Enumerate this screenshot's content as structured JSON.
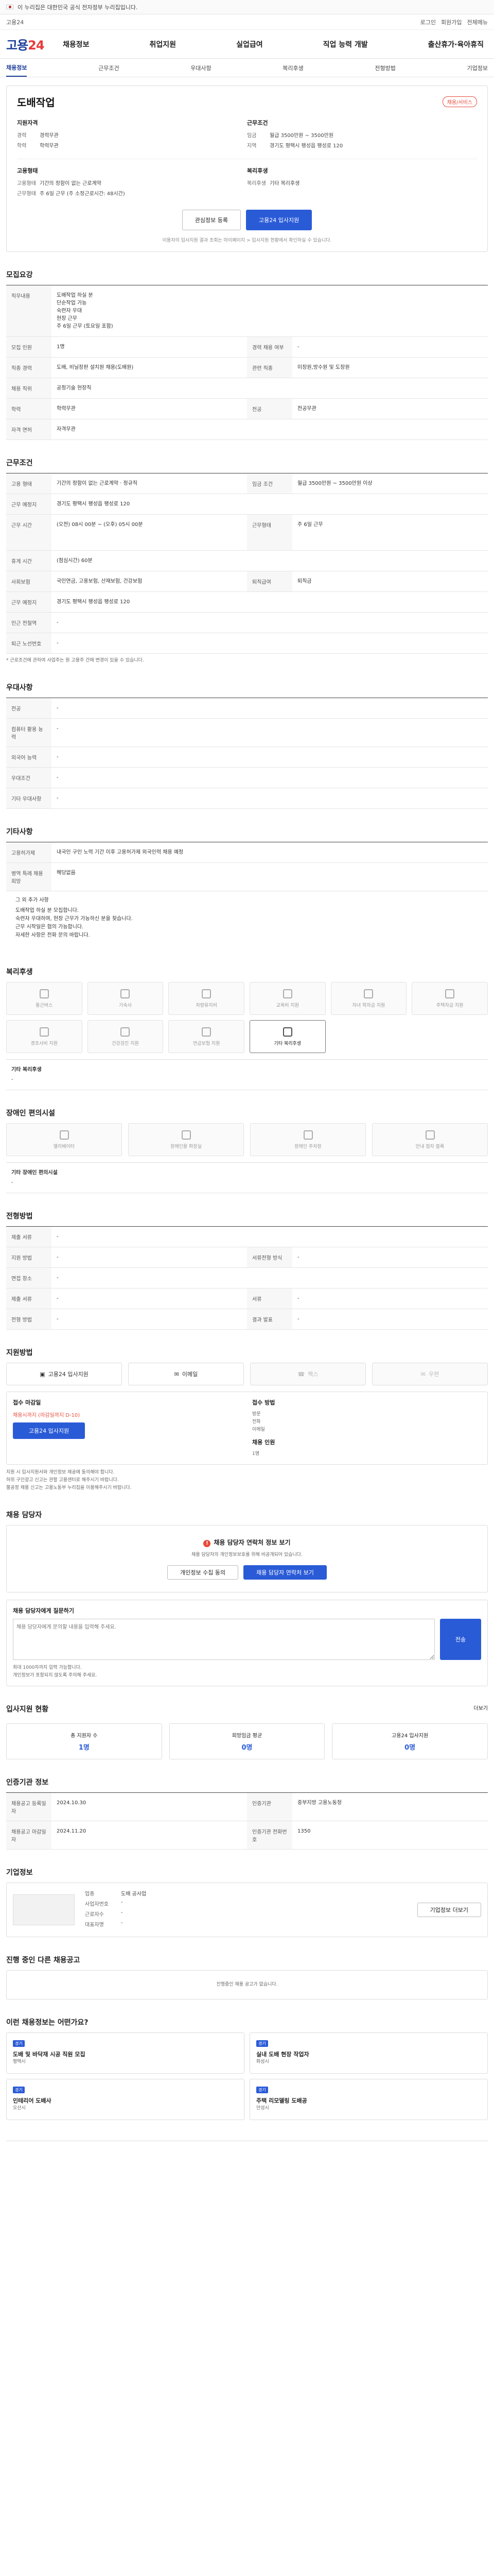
{
  "topbar": {
    "gov_text": "이 누리집은 대한민국 공식 전자정부 누리집입니다."
  },
  "util": {
    "left": "고용24",
    "right_links": [
      "로그인",
      "회원가입",
      "전체메뉴"
    ]
  },
  "header": {
    "logo_main": "고용",
    "logo_num": "24",
    "menu": [
      "채용정보",
      "취업지원",
      "실업급여",
      "직업 능력 개발",
      "출산휴가·육아휴직"
    ]
  },
  "subnav": [
    "채용정보",
    "근무조건",
    "우대사항",
    "복리후생",
    "전형방법",
    "기업정보"
  ],
  "company": {
    "name": "도배작업",
    "status_badge": "채용/서비스",
    "left": {
      "title": "지원자격",
      "rows": [
        [
          "경력",
          "경력무관"
        ],
        [
          "학력",
          "학력무관"
        ]
      ]
    },
    "right": {
      "title": "근무조건",
      "rows": [
        [
          "임금",
          "월급 3500만원 ~ 3500만원"
        ],
        [
          "지역",
          "경기도 평택시 팽성읍 팽성로 120"
        ]
      ]
    },
    "left2": {
      "title": "고용형태",
      "rows": [
        [
          "고용형태",
          "기간의 정함이 없는 근로계약"
        ],
        [
          "근무형태",
          "주 6일 근무 (주 소정근로시간: 48시간)"
        ]
      ]
    },
    "right2": {
      "title": "복리후생",
      "rows": [
        [
          "복리후생",
          "기타 복리후생"
        ]
      ]
    },
    "buttons": {
      "save": "관심정보 등록",
      "apply": "고용24 입사지원"
    },
    "note": "이용자의 입사지원 결과 조회는 마이페이지 > 입사지원 현황에서 확인하실 수 있습니다."
  },
  "recruit": {
    "title": "모집요강",
    "job_desc_label": "직무내용",
    "job_desc": [
      "도배작업 하실 분",
      "단순작업 가능",
      "숙련자 우대",
      "현장 근무",
      "주 6일 근무 (토요일 포함)"
    ],
    "rows": [
      [
        "모집 인원",
        "1명",
        "경력 채용 여부",
        "-"
      ],
      [
        "직종 경력",
        "도배, 비닐장판 설치원 채용(도배원)",
        "관련 직종",
        "미장원,방수원 및 도장원"
      ],
      [
        "채용 직위",
        "공정기술 현장직",
        "",
        ""
      ],
      [
        "학력",
        "학력무관",
        "전공",
        "전공무관"
      ],
      [
        "자격 면허",
        "자격무관",
        "",
        ""
      ]
    ]
  },
  "conditions": {
    "title": "근무조건",
    "rows": [
      [
        "고용 형태",
        "기간의 정함이 없는 근로계약 · 정규직",
        "임금 조건",
        "월급 3500만원 ~ 3500만원 이상"
      ],
      [
        "근무 예정지",
        "경기도 평택시 팽성읍 팽성로 120",
        "",
        ""
      ],
      [
        "근무 시간",
        "(오전) 08시 00분 ~ (오후) 05시 00분",
        "근무형태",
        "주 6일 근무"
      ],
      [
        "휴게 시간",
        "(점심시간) 60분",
        "",
        ""
      ],
      [
        "사회보험",
        "국민연금, 고용보험, 산재보험, 건강보험",
        "퇴직급여",
        "퇴직금"
      ],
      [
        "근무 예정지",
        "경기도 평택시 팽성읍 팽성로 120",
        "",
        ""
      ],
      [
        "인근 전철역",
        "-",
        "",
        ""
      ],
      [
        "퇴근 노선번호",
        "-",
        "",
        ""
      ]
    ],
    "note": "* 근로조건에 관하여 사업주는 원 고용주 간에 변경이 있을 수 있습니다."
  },
  "prefer": {
    "title": "우대사항",
    "rows": [
      [
        "전공",
        "-"
      ],
      [
        "컴퓨터 활용 능력",
        "-"
      ],
      [
        "외국어 능력",
        "-"
      ],
      [
        "우대조건",
        "-"
      ],
      [
        "기타 우대사항",
        "-"
      ]
    ]
  },
  "other": {
    "title": "기타사항",
    "rows": [
      [
        "고용허가제",
        "내국인 구인 노력 기간 이후 고용허가제 외국인력 채용 예정"
      ],
      [
        "병역 특례 채용 희망",
        "해당없음"
      ]
    ],
    "text_title": "그 외 추가 사항",
    "text": [
      "도배작업 하실 분 모집합니다.",
      "숙련자 우대하며, 현장 근무가 가능하신 분을 찾습니다.",
      "근무 시작일은 협의 가능합니다.",
      "자세한 사항은 전화 문의 바랍니다."
    ]
  },
  "welfare": {
    "title": "복리후생",
    "tiles": [
      "통근버스",
      "기숙사",
      "차량유지비",
      "교육비 지원",
      "자녀 학자금 지원",
      "주택자금 지원",
      "경조사비 지원",
      "건강검진 지원",
      "연금보험 지원",
      "기타 복리후생"
    ],
    "extra_title": "기타 복리후생",
    "extra": "-"
  },
  "disability": {
    "title": "장애인 편의시설",
    "tiles": [
      "엘리베이터",
      "장애인용 화장실",
      "장애인 주차장",
      "안내 점자 블록"
    ],
    "extra_title": "기타 장애인 편의시설",
    "extra": "-"
  },
  "process": {
    "title": "전형방법",
    "rows": [
      [
        "제출 서류",
        "-",
        "",
        ""
      ],
      [
        "지원 방법",
        "-",
        "서류전형 방식",
        "-"
      ],
      [
        "면접 장소",
        "-",
        "",
        ""
      ],
      [
        "제출 서류",
        "-",
        "서류",
        "-"
      ],
      [
        "전형 방법",
        "-",
        "결과 발표",
        "-"
      ]
    ]
  },
  "method": {
    "title": "지원방법",
    "items": [
      "고용24 입사지원",
      "이메일",
      "팩스",
      "우편"
    ]
  },
  "period": {
    "title1": "접수 마감일",
    "deadline": "채용시까지 (마감일까지 D-10)",
    "apply": "고용24 입사지원",
    "title2": "접수 방법",
    "method": [
      "방문",
      "전화",
      "이메일"
    ],
    "people_label": "채용 인원",
    "people": "1명",
    "notes": [
      "지원 시 입사지원서와 개인정보 제공에 동의해야 합니다.",
      "허위 구인광고 신고는 관할 고용센터로 해주시기 바랍니다.",
      "불공정 채용 신고는 고용노동부 누리집을 이용해주시기 바랍니다."
    ]
  },
  "contact": {
    "title": "채용 담당자",
    "alert_title": "채용 담당자 연락처 정보 보기",
    "alert_text": "채용 담당자의 개인정보보호를 위해 비공개되어 있습니다.",
    "btn1": "개인정보 수집 동의",
    "btn2": "채용 담당자 연락처 보기"
  },
  "qa": {
    "title": "채용 담당자에게 질문하기",
    "placeholder": "채용 담당자에게 문의할 내용을 입력해 주세요.",
    "button": "전송",
    "notes": [
      "최대 1000자까지 입력 가능합니다.",
      "개인정보가 포함되지 않도록 주의해 주세요."
    ]
  },
  "applicants": {
    "title": "입사지원 현황",
    "more": "더보기",
    "cards": [
      [
        "총 지원자 수",
        "1명"
      ],
      [
        "희망임금 평균",
        "0명"
      ],
      [
        "고용24 입사지원",
        "0명"
      ]
    ]
  },
  "agency": {
    "title": "인증기관 정보",
    "rows": [
      [
        "채용공고 등록일자",
        "2024.10.30",
        "인증기관",
        "중부지방 고용노동청"
      ],
      [
        "채용공고 마감일자",
        "2024.11.20",
        "인증기관 전화번호",
        "1350"
      ]
    ]
  },
  "corp": {
    "title": "기업정보",
    "rows": [
      [
        "업종",
        "도배 공사업"
      ],
      [
        "사업자번호",
        "-"
      ],
      [
        "근로자수",
        "-"
      ],
      [
        "대표자명",
        "-"
      ]
    ],
    "button": "기업정보 더보기"
  },
  "similar": {
    "title": "진행 중인 다른 채용공고",
    "empty": "진행중인 채용 공고가 없습니다."
  },
  "related": {
    "title": "이런 채용정보는 어떤가요?",
    "items": [
      [
        "경기",
        "도배 및 바닥재 시공 직원 모집",
        "평택시"
      ],
      [
        "경기",
        "실내 도배 현장 작업자",
        "화성시"
      ],
      [
        "경기",
        "인테리어 도배사",
        "오산시"
      ],
      [
        "경기",
        "주택 리모델링 도배공",
        "안성시"
      ]
    ]
  }
}
